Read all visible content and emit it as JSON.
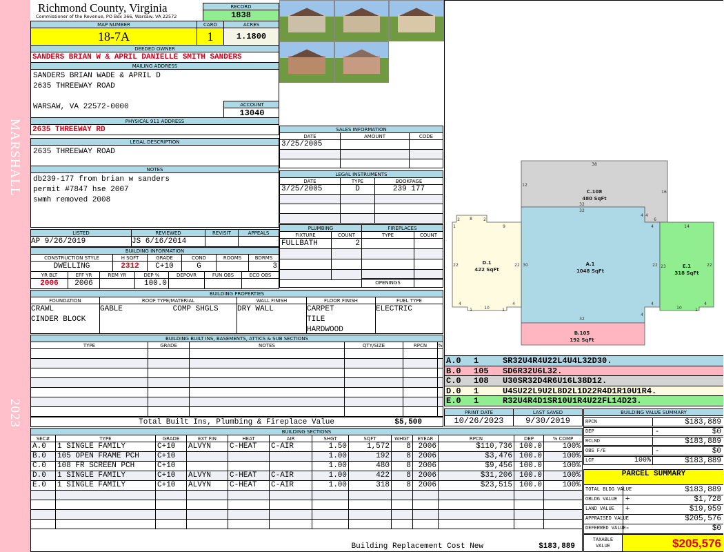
{
  "side": {
    "top": "MARSHALL",
    "bottom": "2023"
  },
  "header": {
    "county": "Richmond County, Virginia",
    "commissioner": "Commissioner of the Revenue, PO Box 366, Warsaw, VA 22572"
  },
  "record": {
    "label": "RECORD",
    "value": "1838"
  },
  "map": {
    "map_label": "MAP NUMBER",
    "map_value": "18-7A",
    "card_label": "CARD",
    "card_value": "1",
    "acres_label": "ACRES",
    "acres_value": "1.1800"
  },
  "owner": {
    "label": "DEEDED OWNER",
    "value": "SANDERS BRIAN W & APRIL DANIELLE SMITH SANDERS"
  },
  "mailing": {
    "label": "MAILING ADDRESS",
    "lines": [
      "SANDERS BRIAN WADE & APRIL D",
      "2635 THREEWAY ROAD",
      "",
      "WARSAW, VA 22572-0000"
    ]
  },
  "account": {
    "label": "ACCOUNT",
    "value": "13040"
  },
  "physical": {
    "label": "PHYSICAL 911 ADDRESS",
    "value": "2635 THREEWAY RD"
  },
  "legal": {
    "label": "LEGAL DESCRIPTION",
    "value": "2635 THREEWAY ROAD"
  },
  "notes": {
    "label": "NOTES",
    "lines": [
      "db239-177 from brian w sanders",
      "permit #7847 hse 2007",
      "swmh removed 2008"
    ]
  },
  "sales": {
    "label": "SALES INFORMATION",
    "cols": [
      "DATE",
      "AMOUNT",
      "CODE"
    ],
    "rows": [
      [
        "3/25/2005",
        "",
        ""
      ],
      [
        "",
        "",
        ""
      ],
      [
        "",
        "",
        ""
      ]
    ]
  },
  "instruments": {
    "label": "LEGAL INSTRUMENTS",
    "cols": [
      "DATE",
      "TYPE",
      "BOOKPAGE"
    ],
    "rows": [
      [
        "3/25/2005",
        "D",
        "239 177"
      ],
      [
        "",
        "",
        ""
      ],
      [
        "",
        "",
        ""
      ],
      [
        "",
        "",
        ""
      ]
    ]
  },
  "listing": {
    "cols": [
      "LISTED",
      "REVIEWED",
      "REVISIT",
      "APPEALS"
    ],
    "listed": "AP    9/26/2019",
    "reviewed": "JS    6/16/2014",
    "revisit": "",
    "appeals": ""
  },
  "building_info": {
    "label": "BUILDING INFORMATION",
    "cols1": [
      "CONSTRUCTION STYLE",
      "H SQFT",
      "GRADE",
      "COND",
      "ROOMS",
      "BDRMS"
    ],
    "vals1": [
      "DWELLING",
      "2312",
      "C+10",
      "G",
      "",
      "3"
    ],
    "cols2": [
      "YR BLT",
      "EFF YR",
      "REM YR",
      "DEP %",
      "DEPOVR",
      "FUN OBS",
      "ECO OBS"
    ],
    "vals2": [
      "2006",
      "2006",
      "",
      "100.0",
      "",
      "",
      ""
    ]
  },
  "plumbing": {
    "label": "PLUMBING",
    "cols": [
      "FIXTURE",
      "COUNT"
    ],
    "rows": [
      [
        "FULLBATH",
        "2"
      ],
      [
        "",
        ""
      ],
      [
        "",
        ""
      ],
      [
        "",
        ""
      ]
    ]
  },
  "fireplaces": {
    "label": "FIREPLACES",
    "cols": [
      "TYPE",
      "COUNT"
    ],
    "rows": [
      [
        "",
        ""
      ],
      [
        "",
        ""
      ],
      [
        "",
        ""
      ],
      [
        "",
        ""
      ]
    ],
    "openings_label": "OPENINGS",
    "openings": ""
  },
  "properties": {
    "label": "BUILDING PROPERTIES",
    "cols": [
      "FOUNDATION",
      "ROOF TYPE/MATERIAL",
      "WALL FINISH",
      "FLOOR FINISH",
      "FUEL TYPE"
    ],
    "foundation": [
      "CRAWL",
      "CINDER BLOCK"
    ],
    "roof": [
      "GABLE           COMP SHGLS"
    ],
    "wall": [
      "DRY WALL"
    ],
    "floor": [
      "CARPET",
      "TILE",
      "HARDWOOD"
    ],
    "fuel": [
      "ELECTRIC"
    ]
  },
  "builtins": {
    "label": "BUILDING BUILT INS, BASEMENTS, ATTICS & SUB SECTIONS",
    "cols": [
      "TYPE",
      "GRADE",
      "NOTES",
      "QTY/SIZE",
      "RPCN",
      "% COMP"
    ],
    "total_label": "Total Built Ins, Plumbing & Fireplace Value",
    "total_value": "$5,500"
  },
  "sketch": {
    "sections": [
      {
        "name": "C.108",
        "area": "480 SqFt"
      },
      {
        "name": "A.1",
        "area": "1048 SqFt"
      },
      {
        "name": "D.1",
        "area": "422 SqFt"
      },
      {
        "name": "E.1",
        "area": "318 SqFt"
      },
      {
        "name": "B.105",
        "area": "192 SqFt"
      }
    ],
    "dims": [
      "38",
      "12",
      "16",
      "32",
      "32",
      "4",
      "4",
      "6",
      "4",
      "14",
      "1",
      "2",
      "8",
      "2",
      "9",
      "22",
      "22",
      "30",
      "22",
      "23",
      "22",
      "4",
      "10",
      "1",
      "1",
      "4",
      "4",
      "4",
      "32",
      "10",
      "1",
      "4"
    ],
    "codes": [
      {
        "sec": "A.0",
        "num": "1",
        "path": "SR32U4R4U22L4U4L32D30.",
        "color": "#add8e6"
      },
      {
        "sec": "B.0",
        "num": "105",
        "path": "SD6R32U6L32.",
        "color": "#ffb6c1"
      },
      {
        "sec": "C.0",
        "num": "108",
        "path": "U30SR32D4R6U16L38D12.",
        "color": "#d3d3d3"
      },
      {
        "sec": "D.0",
        "num": "1",
        "path": "U4SU22L9U2L8D2L1D22R4D1R10U1R4.",
        "color": "#fffbe0"
      },
      {
        "sec": "E.0",
        "num": "1",
        "path": "R32U4R4D1SR10U1R4U22FL14D23.",
        "color": "#90ee90"
      }
    ]
  },
  "dates": {
    "print_label": "PRINT DATE",
    "print_value": "10/26/2023",
    "saved_label": "LAST SAVED",
    "saved_value": "9/30/2019"
  },
  "value_summary": {
    "label": "BUILDING VALUE SUMMARY",
    "rows": [
      {
        "label": "RPCN",
        "op": "",
        "pct": "",
        "value": "$183,889"
      },
      {
        "label": "DEP",
        "op": "-",
        "pct": "",
        "value": "$0"
      },
      {
        "label": "RCLND",
        "op": "",
        "pct": "",
        "value": "$183,889"
      },
      {
        "label": "OBS F/E",
        "op": "-",
        "pct": "",
        "value": "$0"
      },
      {
        "label": "LCF",
        "op": "",
        "pct": "100%",
        "value": "$183,889"
      }
    ]
  },
  "parcel": {
    "label": "PARCEL SUMMARY",
    "rows": [
      {
        "label": "TOTAL BLDG VALUE",
        "op": "",
        "value": "$183,889"
      },
      {
        "label": "OBLDG VALUE",
        "op": "+",
        "value": "$1,728"
      },
      {
        "label": "LAND VALUE",
        "op": "+",
        "value": "$19,959"
      },
      {
        "label": "APPRAISED VALUE",
        "op": "",
        "value": "$205,576"
      },
      {
        "label": "DEFERRED VALUE",
        "op": "-",
        "value": "$0"
      }
    ],
    "taxable_label": "TAXABLE VALUE",
    "taxable_value": "$205,576"
  },
  "sections": {
    "label": "BUILDING SECTIONS",
    "cols": [
      "SEC#",
      "TYPE",
      "GRADE",
      "EXT FIN",
      "HEAT",
      "AIR",
      "SHGT",
      "SQFT",
      "WHGT",
      "EYEAR",
      "RPCN",
      "DEP",
      "% COMP"
    ],
    "rows": [
      [
        "A.0",
        "  1 SINGLE FAMILY",
        "C+10",
        "ALVYN",
        "C-HEAT",
        "C-AIR",
        "1.50",
        "1,572",
        "8",
        "2006",
        "$110,736",
        "100.0",
        "100%"
      ],
      [
        "B.0",
        "105 OPEN FRAME PCH",
        "C+10",
        "",
        "",
        "",
        "1.00",
        "192",
        "8",
        "2006",
        "$3,476",
        "100.0",
        "100%"
      ],
      [
        "C.0",
        "108 FR SCREEN PCH",
        "C+10",
        "",
        "",
        "",
        "1.00",
        "480",
        "8",
        "2006",
        "$9,456",
        "100.0",
        "100%"
      ],
      [
        "D.0",
        "  1 SINGLE FAMILY",
        "C+10",
        "ALVYN",
        "C-HEAT",
        "C-AIR",
        "1.00",
        "422",
        "8",
        "2006",
        "$31,206",
        "100.0",
        "100%"
      ],
      [
        "E.0",
        "  1 SINGLE FAMILY",
        "C+10",
        "ALVYN",
        "C-HEAT",
        "C-AIR",
        "1.00",
        "318",
        "8",
        "2006",
        "$23,515",
        "100.0",
        "100%"
      ]
    ],
    "total_label": "Building Replacement Cost New",
    "total_value": "$183,889"
  }
}
